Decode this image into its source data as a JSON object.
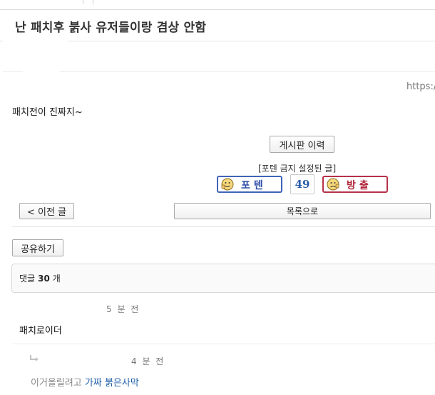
{
  "post": {
    "title": "난 패치후 붉사 유저들이랑 겸상 안함",
    "source_url": "https://",
    "body": "패치전이 진짜지~"
  },
  "actions": {
    "history_label": "게시판 이력",
    "ban_note": "[포텐 금지 설정된 글]",
    "vote_up_label": "포텐",
    "vote_count": "49",
    "vote_down_label": "방출",
    "prev_label": "< 이전 글",
    "list_label": "목록으로",
    "share_label": "공유하기"
  },
  "comments": {
    "header_prefix": "댓글",
    "count": "30",
    "header_suffix": "개",
    "items": [
      {
        "time": "5 분 전",
        "text": "패치로이더"
      },
      {
        "time": "4 분 전",
        "text": "이거올릴려고",
        "link": "가짜 붉은사막",
        "is_reply": true
      }
    ]
  },
  "icons": {
    "vote_up": "thumbs-up-face-icon",
    "vote_down": "thumbs-down-face-icon",
    "reply": "reply-arrow-icon"
  },
  "colors": {
    "vote_up": "#3f63b8",
    "vote_down": "#b8314a",
    "vote_count": "#2a5caa",
    "link": "#1f5fa8"
  }
}
